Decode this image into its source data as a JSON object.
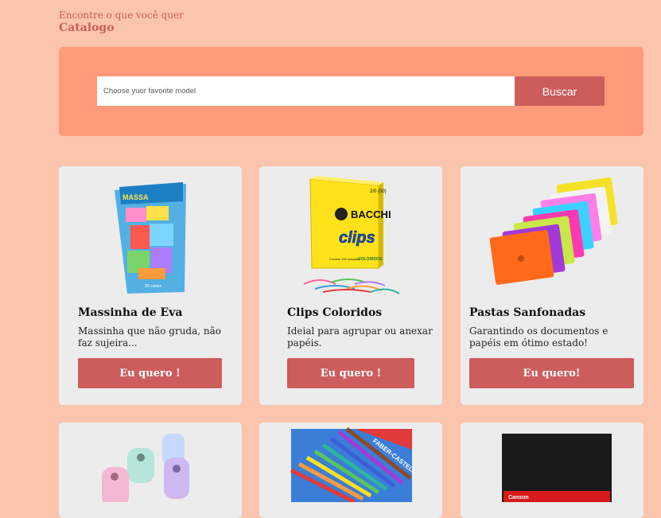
{
  "header": {
    "subtitle": "Encontre o que você quer",
    "title": "Catalogo"
  },
  "search": {
    "placeholder": "Choose yuor favorite model",
    "button_label": "Buscar"
  },
  "products": [
    {
      "title": "Massinha de Eva",
      "description": "Massinha que não gruda, não faz sujeira...",
      "button": "Eu quero !"
    },
    {
      "title": "Clips Coloridos",
      "description": "Ideial para agrupar ou anexar papéis.",
      "button": "Eu quero !"
    },
    {
      "title": "Pastas Sanfonadas",
      "description": "Garantindo os documentos e papéis em ótimo estado!",
      "button": "Eu quero!"
    }
  ],
  "images": {
    "massinha": {
      "label_top": "MASSA",
      "label_bottom": "20 cores"
    },
    "clips": {
      "brand": "BACCHI",
      "logo": "clips",
      "size": "2/0 (00)",
      "colors_label": "COLORIDOS",
      "count": "Contém 100 unidades"
    },
    "lapis": {
      "brand": "FABER-CASTELL"
    },
    "sketchbook": {
      "brand": "Canson"
    }
  },
  "colors": {
    "background": "#fbc4ad",
    "panel": "#ff9b7a",
    "accent": "#cd5c5c"
  }
}
